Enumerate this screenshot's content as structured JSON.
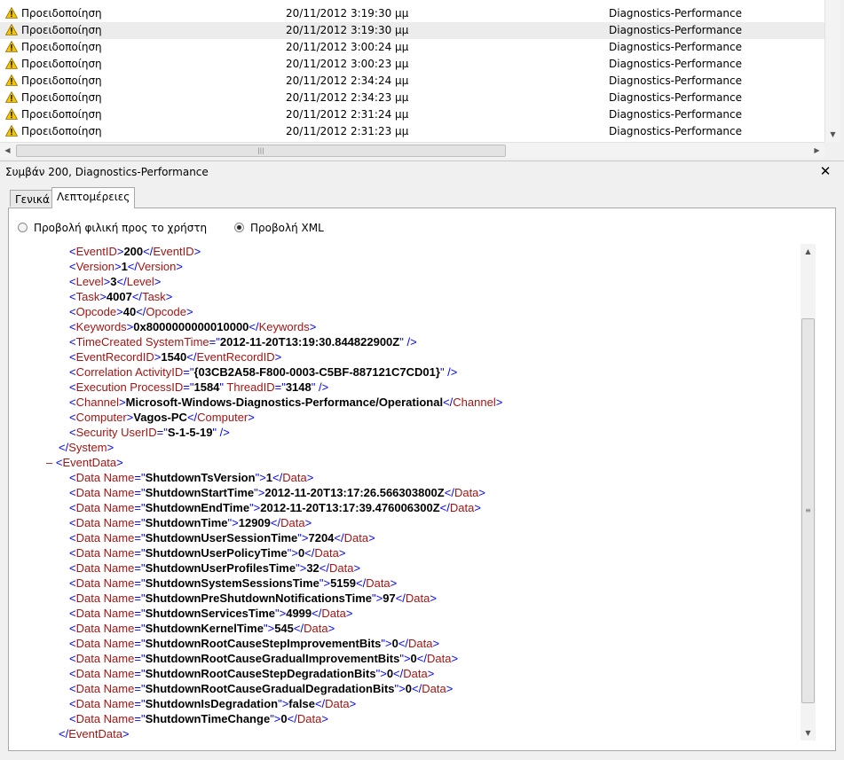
{
  "event_list": {
    "rows": [
      {
        "level": "Προειδοποίηση",
        "datetime": "20/11/2012 3:19:30 μμ",
        "source": "Diagnostics-Performance",
        "selected": false
      },
      {
        "level": "Προειδοποίηση",
        "datetime": "20/11/2012 3:19:30 μμ",
        "source": "Diagnostics-Performance",
        "selected": true
      },
      {
        "level": "Προειδοποίηση",
        "datetime": "20/11/2012 3:00:24 μμ",
        "source": "Diagnostics-Performance",
        "selected": false
      },
      {
        "level": "Προειδοποίηση",
        "datetime": "20/11/2012 3:00:23 μμ",
        "source": "Diagnostics-Performance",
        "selected": false
      },
      {
        "level": "Προειδοποίηση",
        "datetime": "20/11/2012 2:34:24 μμ",
        "source": "Diagnostics-Performance",
        "selected": false
      },
      {
        "level": "Προειδοποίηση",
        "datetime": "20/11/2012 2:34:23 μμ",
        "source": "Diagnostics-Performance",
        "selected": false
      },
      {
        "level": "Προειδοποίηση",
        "datetime": "20/11/2012 2:31:24 μμ",
        "source": "Diagnostics-Performance",
        "selected": false
      },
      {
        "level": "Προειδοποίηση",
        "datetime": "20/11/2012 2:31:23 μμ",
        "source": "Diagnostics-Performance",
        "selected": false
      }
    ],
    "row_icon": "warning-icon"
  },
  "detail": {
    "title": "Συμβάν 200, Diagnostics-Performance",
    "close_label": "✕",
    "tabs": [
      {
        "label": "Γενικά",
        "active": false
      },
      {
        "label": "Λεπτομέρειες",
        "active": true
      }
    ],
    "radio_friendly": "Προβολή φιλική προς το χρήστη",
    "radio_xml": "Προβολή XML",
    "selected_view": "xml"
  },
  "xml": {
    "system_elements": [
      {
        "tag": "EventID",
        "value": "200"
      },
      {
        "tag": "Version",
        "value": "1"
      },
      {
        "tag": "Level",
        "value": "3"
      },
      {
        "tag": "Task",
        "value": "4007"
      },
      {
        "tag": "Opcode",
        "value": "40"
      },
      {
        "tag": "Keywords",
        "value": "0x8000000000010000"
      }
    ],
    "time_created": {
      "tag": "TimeCreated",
      "attr": "SystemTime",
      "value": "2012-11-20T13:19:30.844822900Z"
    },
    "event_record": {
      "tag": "EventRecordID",
      "value": "1540"
    },
    "correlation": {
      "tag": "Correlation",
      "attr": "ActivityID",
      "value": "{03CB2A58-F800-0003-C5BF-887121C7CD01}"
    },
    "execution": {
      "tag": "Execution",
      "attr1": "ProcessID",
      "value1": "1584",
      "attr2": "ThreadID",
      "value2": "3148"
    },
    "channel": {
      "tag": "Channel",
      "value": "Microsoft-Windows-Diagnostics-Performance/Operational"
    },
    "computer": {
      "tag": "Computer",
      "value": "Vagos-PC"
    },
    "security": {
      "tag": "Security",
      "attr": "UserID",
      "value": "S-1-5-19"
    },
    "system_close": "System",
    "event_data_tag": "EventData",
    "data_tag": "Data",
    "data_attr": "Name",
    "data_items": [
      {
        "name": "ShutdownTsVersion",
        "value": "1"
      },
      {
        "name": "ShutdownStartTime",
        "value": "2012-11-20T13:17:26.566303800Z"
      },
      {
        "name": "ShutdownEndTime",
        "value": "2012-11-20T13:17:39.476006300Z"
      },
      {
        "name": "ShutdownTime",
        "value": "12909"
      },
      {
        "name": "ShutdownUserSessionTime",
        "value": "7204"
      },
      {
        "name": "ShutdownUserPolicyTime",
        "value": "0"
      },
      {
        "name": "ShutdownUserProfilesTime",
        "value": "32"
      },
      {
        "name": "ShutdownSystemSessionsTime",
        "value": "5159"
      },
      {
        "name": "ShutdownPreShutdownNotificationsTime",
        "value": "97"
      },
      {
        "name": "ShutdownServicesTime",
        "value": "4999"
      },
      {
        "name": "ShutdownKernelTime",
        "value": "545"
      },
      {
        "name": "ShutdownRootCauseStepImprovementBits",
        "value": "0"
      },
      {
        "name": "ShutdownRootCauseGradualImprovementBits",
        "value": "0"
      },
      {
        "name": "ShutdownRootCauseStepDegradationBits",
        "value": "0"
      },
      {
        "name": "ShutdownRootCauseGradualDegradationBits",
        "value": "0"
      },
      {
        "name": "ShutdownIsDegradation",
        "value": "false"
      },
      {
        "name": "ShutdownTimeChange",
        "value": "0"
      }
    ],
    "collapse_symbol": "–"
  },
  "colors": {
    "tag": "#a31515",
    "bracket": "#0000ff",
    "warning": "#f5c400"
  }
}
